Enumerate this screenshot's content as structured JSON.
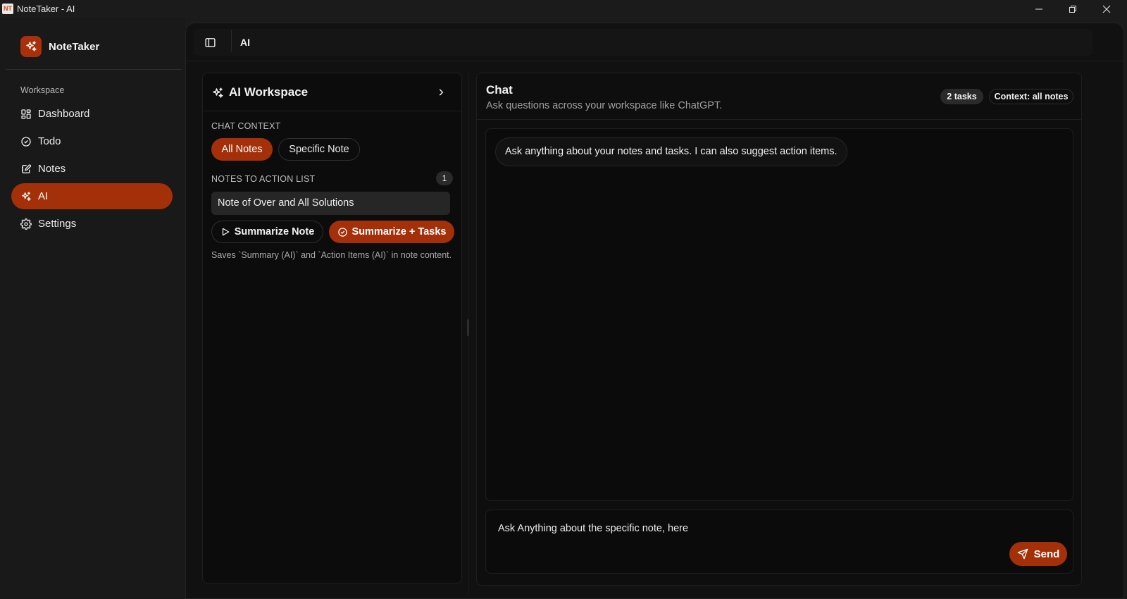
{
  "window": {
    "title": "NoteTaker - AI",
    "icon_text": "NT"
  },
  "sidebar": {
    "brand": "NoteTaker",
    "section": "Workspace",
    "items": [
      {
        "label": "Dashboard",
        "icon": "dashboard-icon"
      },
      {
        "label": "Todo",
        "icon": "check-circle-icon"
      },
      {
        "label": "Notes",
        "icon": "notebook-icon"
      },
      {
        "label": "AI",
        "icon": "sparkles-icon",
        "active": true
      },
      {
        "label": "Settings",
        "icon": "gear-icon"
      }
    ]
  },
  "topbar": {
    "title": "AI"
  },
  "workspace": {
    "title": "AI Workspace",
    "chat_context_label": "CHAT CONTEXT",
    "context_options": [
      "All Notes",
      "Specific Note"
    ],
    "selected_context": "All Notes",
    "action_list_label": "NOTES TO ACTION LIST",
    "action_count": "1",
    "selected_note": "Note of Over and All Solutions",
    "summarize_label": "Summarize Note",
    "summarize_tasks_label": "Summarize + Tasks",
    "note": "Saves `Summary (AI)` and `Action Items (AI)` in note content."
  },
  "chat": {
    "title": "Chat",
    "subtitle": "Ask questions across your workspace like ChatGPT.",
    "tasks_badge": "2 tasks",
    "context_badge": "Context: all notes",
    "messages": [
      {
        "role": "assistant",
        "text": "Ask anything about your notes and tasks. I can also suggest action items."
      }
    ],
    "input_placeholder": "Ask Anything about the specific note, here",
    "send_label": "Send"
  },
  "colors": {
    "accent": "#a4300a",
    "background": "#111111",
    "sidebar": "#191919"
  }
}
